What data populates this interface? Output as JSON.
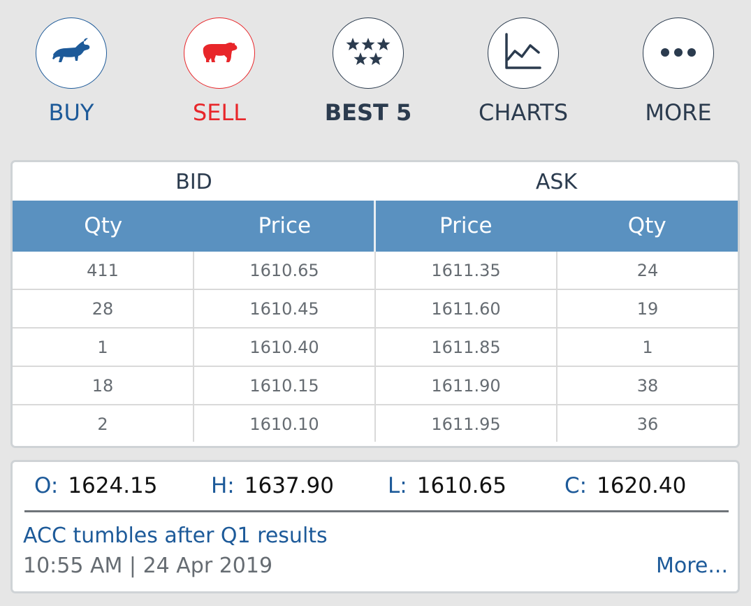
{
  "actions": {
    "buy": "BUY",
    "sell": "SELL",
    "best5": "BEST 5",
    "charts": "CHARTS",
    "more": "MORE"
  },
  "colors": {
    "buy": "#1d5a99",
    "sell": "#e8262a",
    "dark": "#2b3b4e",
    "table_header": "#5a91c0"
  },
  "icons": {
    "buy": "bull-icon",
    "sell": "bear-icon",
    "best5": "stars-icon",
    "charts": "line-chart-icon",
    "more": "ellipsis-icon"
  },
  "depth": {
    "bid_label": "BID",
    "ask_label": "ASK",
    "columns": [
      "Qty",
      "Price",
      "Price",
      "Qty"
    ],
    "rows": [
      [
        "411",
        "1610.65",
        "1611.35",
        "24"
      ],
      [
        "28",
        "1610.45",
        "1611.60",
        "19"
      ],
      [
        "1",
        "1610.40",
        "1611.85",
        "1"
      ],
      [
        "18",
        "1610.15",
        "1611.90",
        "38"
      ],
      [
        "2",
        "1610.10",
        "1611.95",
        "36"
      ]
    ]
  },
  "ohlc": {
    "open_label": "O:",
    "open": "1624.15",
    "high_label": "H:",
    "high": "1637.90",
    "low_label": "L:",
    "low": "1610.65",
    "close_label": "C:",
    "close": "1620.40"
  },
  "news": {
    "headline": "ACC tumbles after Q1 results",
    "timestamp": "10:55 AM | 24 Apr 2019",
    "more_link": "More..."
  }
}
